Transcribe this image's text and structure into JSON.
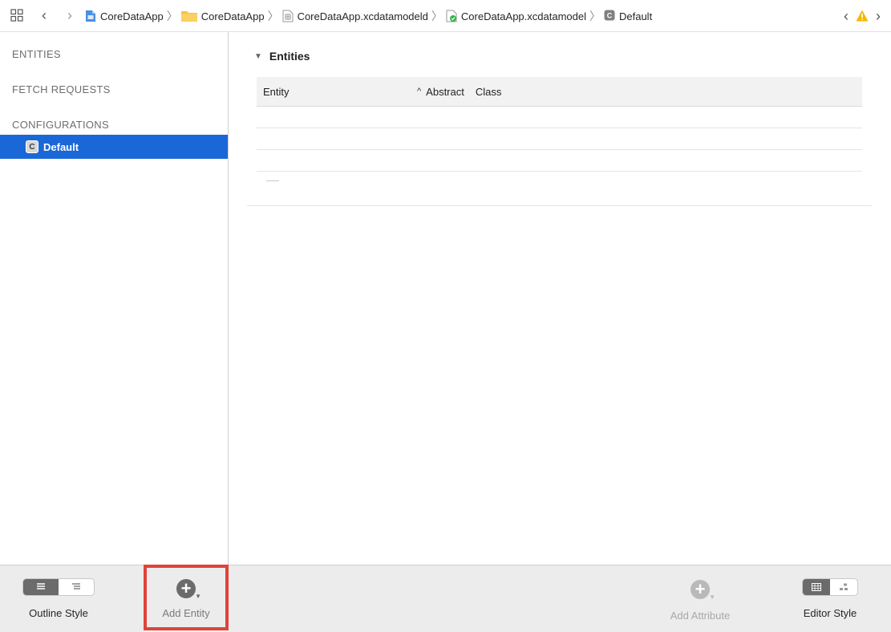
{
  "jumpbar": {
    "nav_back": "‹",
    "nav_forward": "›",
    "crumbs": [
      {
        "label": "CoreDataApp",
        "icon": "project-file-icon"
      },
      {
        "label": "CoreDataApp",
        "icon": "folder-icon"
      },
      {
        "label": "CoreDataApp.xcdatamodeld",
        "icon": "model-bundle-icon"
      },
      {
        "label": "CoreDataApp.xcdatamodel",
        "icon": "datamodel-file-icon"
      },
      {
        "label": "Default",
        "icon": "configuration-icon"
      }
    ],
    "issue_prev": "‹",
    "issue_next": "›"
  },
  "sidebar": {
    "entities": "ENTITIES",
    "fetch_requests": "FETCH REQUESTS",
    "configurations": "CONFIGURATIONS",
    "selected_item": {
      "badge": "C",
      "label": "Default"
    }
  },
  "editor": {
    "section_title": "Entities",
    "columns": {
      "entity": "Entity",
      "sort": "^",
      "abstract": "Abstract",
      "class": "Class"
    },
    "rows": []
  },
  "toolbar": {
    "outline_style": "Outline Style",
    "add_entity": "Add Entity",
    "add_attribute": "Add Attribute",
    "editor_style": "Editor Style"
  },
  "colors": {
    "selection": "#1a67d8",
    "highlight_border": "#e0433a",
    "warning": "#f5b800",
    "folder": "#f6c343"
  }
}
